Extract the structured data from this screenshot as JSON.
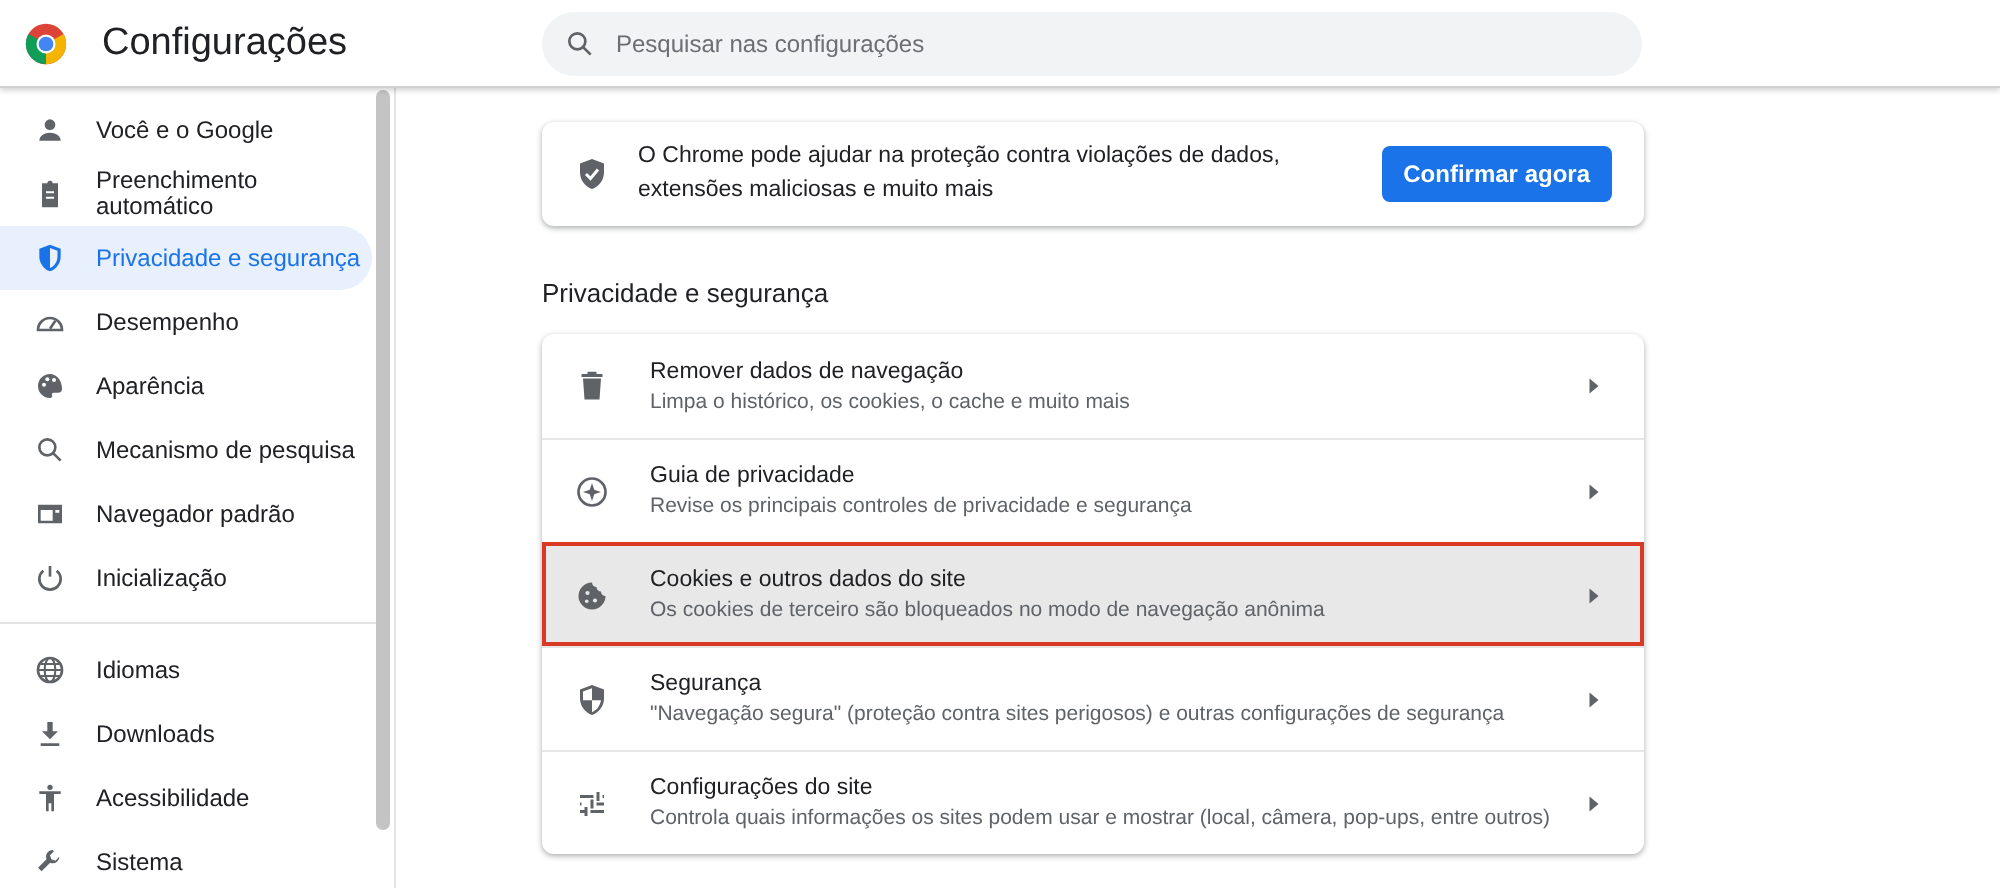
{
  "header": {
    "title": "Configurações",
    "search": {
      "placeholder": "Pesquisar nas configurações"
    }
  },
  "sidebar": {
    "groups": [
      [
        {
          "label": "Você e o Google",
          "selected": false
        },
        {
          "label": "Preenchimento automático",
          "selected": false
        },
        {
          "label": "Privacidade e segurança",
          "selected": true
        },
        {
          "label": "Desempenho",
          "selected": false
        },
        {
          "label": "Aparência",
          "selected": false
        },
        {
          "label": "Mecanismo de pesquisa",
          "selected": false
        },
        {
          "label": "Navegador padrão",
          "selected": false
        },
        {
          "label": "Inicialização",
          "selected": false
        }
      ],
      [
        {
          "label": "Idiomas",
          "selected": false
        },
        {
          "label": "Downloads",
          "selected": false
        },
        {
          "label": "Acessibilidade",
          "selected": false
        },
        {
          "label": "Sistema",
          "selected": false
        }
      ]
    ]
  },
  "safety_check": {
    "text": "O Chrome pode ajudar na proteção contra violações de dados, extensões maliciosas e muito mais",
    "button": "Confirmar agora"
  },
  "privacy": {
    "heading": "Privacidade e segurança",
    "rows": [
      {
        "title": "Remover dados de navegação",
        "subtitle": "Limpa o histórico, os cookies, o cache e muito mais",
        "selected": false
      },
      {
        "title": "Guia de privacidade",
        "subtitle": "Revise os principais controles de privacidade e segurança",
        "selected": false
      },
      {
        "title": "Cookies e outros dados do site",
        "subtitle": "Os cookies de terceiro são bloqueados no modo de navegação anônima",
        "selected": true
      },
      {
        "title": "Segurança",
        "subtitle": "\"Navegação segura\" (proteção contra sites perigosos) e outras configurações de segurança",
        "selected": false
      },
      {
        "title": "Configurações do site",
        "subtitle": "Controla quais informações os sites podem usar e mostrar (local, câmera, pop-ups, entre outros)",
        "selected": false
      }
    ]
  }
}
